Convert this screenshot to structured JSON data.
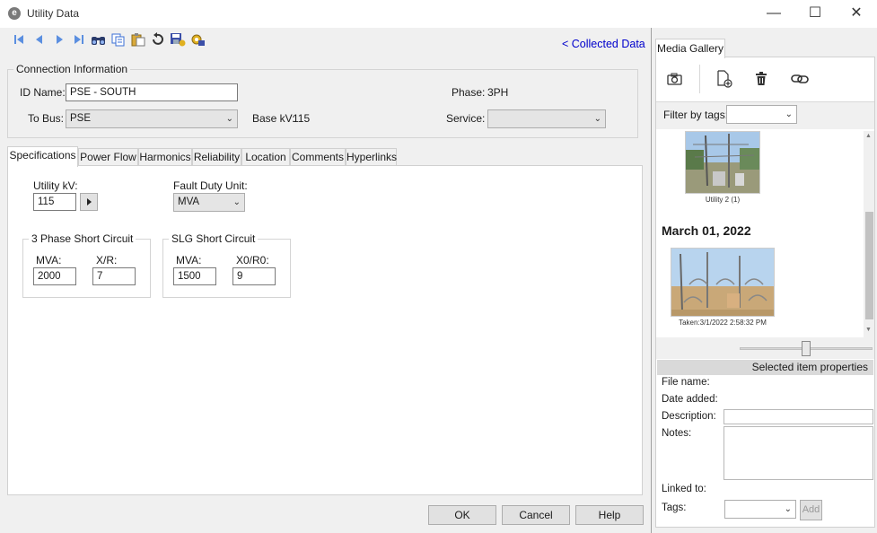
{
  "window": {
    "title": "Utility Data",
    "minimize": "—",
    "maximize": "☐",
    "close": "✕"
  },
  "toolbar": {
    "icons": [
      "first-record-icon",
      "prev-record-icon",
      "next-record-icon",
      "last-record-icon",
      "find-icon",
      "copy-icon",
      "paste-icon",
      "undo-icon",
      "save-icon",
      "settings-icon"
    ],
    "collected_data_link": "< Collected Data"
  },
  "connection": {
    "legend": "Connection Information",
    "id_name_label": "ID Name:",
    "id_name_value": "PSE - SOUTH",
    "phase_label": "Phase:",
    "phase_value": "3PH",
    "to_bus_label": "To Bus:",
    "to_bus_value": "PSE",
    "base_kv_label": "Base kV:",
    "base_kv_value": "115",
    "service_label": "Service:",
    "service_value": ""
  },
  "tabs": [
    "Specifications",
    "Power Flow",
    "Harmonics",
    "Reliability",
    "Location",
    "Comments",
    "Hyperlinks"
  ],
  "specifications": {
    "utility_kv_label": "Utility kV:",
    "utility_kv_value": "115",
    "fault_duty_unit_label": "Fault Duty Unit:",
    "fault_duty_unit_value": "MVA",
    "three_phase": {
      "legend": "3 Phase Short Circuit",
      "mva_label": "MVA:",
      "mva_value": "2000",
      "xr_label": "X/R:",
      "xr_value": "7"
    },
    "slg": {
      "legend": "SLG Short Circuit",
      "mva_label": "MVA:",
      "mva_value": "1500",
      "x0r0_label": "X0/R0:",
      "x0r0_value": "9"
    }
  },
  "buttons": {
    "ok": "OK",
    "cancel": "Cancel",
    "help": "Help"
  },
  "gallery": {
    "tab_label": "Media Gallery",
    "tool_icons": [
      "camera-icon",
      "add-file-icon",
      "delete-icon",
      "link-icon"
    ],
    "filter_label": "Filter by tags:",
    "filter_value": "",
    "item1_caption": "Utility 2 (1)",
    "date_header": "March 01, 2022",
    "item2_caption": "Taken:3/1/2022 2:58:32 PM",
    "zoom_level": 0.5,
    "props_header": "Selected item properties",
    "file_name_label": "File name:",
    "date_added_label": "Date added:",
    "description_label": "Description:",
    "notes_label": "Notes:",
    "linked_to_label": "Linked to:",
    "tags_label": "Tags:",
    "tags_value": "",
    "add_button": "Add"
  },
  "colors": {
    "link": "#0000cc",
    "toolbar_blue": "#3b6fd6",
    "window_bg": "#f0f0f0"
  }
}
